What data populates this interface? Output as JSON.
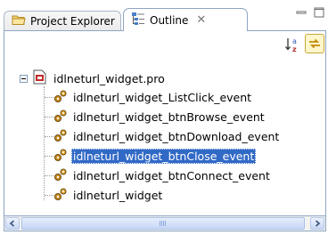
{
  "tabs": [
    {
      "label": "Project Explorer",
      "icon": "folder-icon",
      "active": false
    },
    {
      "label": "Outline",
      "icon": "outline-icon",
      "active": true
    }
  ],
  "window_controls": [
    "minimize-icon",
    "maximize-icon"
  ],
  "toolbar": {
    "sort_icon": "sort-alphabetical-icon",
    "link_icon": "link-with-editor-icon"
  },
  "tree": {
    "root": {
      "label": "idlneturl_widget.pro",
      "icon": "pro-file-icon",
      "expanded": true
    },
    "children": [
      {
        "label": "idlneturl_widget_ListClick_event",
        "icon": "procedure-gear-icon",
        "selected": false
      },
      {
        "label": "idlneturl_widget_btnBrowse_event",
        "icon": "procedure-gear-icon",
        "selected": false
      },
      {
        "label": "idlneturl_widget_btnDownload_event",
        "icon": "procedure-gear-icon",
        "selected": false
      },
      {
        "label": "idlneturl_widget_btnClose_event",
        "icon": "procedure-gear-icon",
        "selected": true
      },
      {
        "label": "idlneturl_widget_btnConnect_event",
        "icon": "procedure-gear-icon",
        "selected": false
      },
      {
        "label": "idlneturl_widget",
        "icon": "procedure-gear-icon",
        "selected": false
      }
    ]
  },
  "colors": {
    "selection": "#3169c6",
    "border": "#8ea4c1",
    "gear": "#c88a1e"
  }
}
